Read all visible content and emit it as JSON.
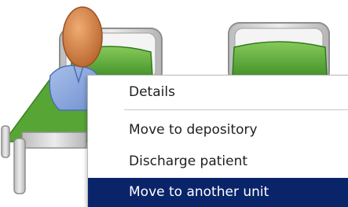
{
  "context_menu": {
    "items": [
      {
        "label": "Details",
        "selected": false
      },
      {
        "label": "Move to depository",
        "selected": false
      },
      {
        "label": "Discharge patient",
        "selected": false
      },
      {
        "label": "Move to another unit",
        "selected": true
      }
    ],
    "highlight_color": "#0a246a"
  },
  "icons": {
    "occupied_bed": "bed-with-patient-icon",
    "empty_bed": "empty-bed-icon",
    "patient": "patient-avatar-icon"
  },
  "colors": {
    "pillow_green": "#5faa3a",
    "sheet_green": "#57a535",
    "bed_frame": "#c9c9c9",
    "patient_head": "#d7874b",
    "patient_shirt": "#88a6dc"
  }
}
